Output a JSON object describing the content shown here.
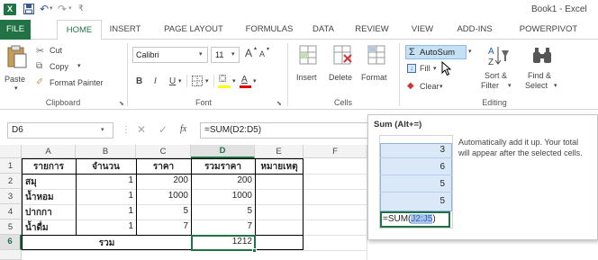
{
  "title": {
    "window_title": "Book1 - Excel",
    "logo_text": "X"
  },
  "quick_access": {
    "save_icon": "save-icon",
    "undo_icon": "undo-icon",
    "redo_icon": "redo-icon",
    "customize_icon": "customize-icon"
  },
  "tabs": [
    "FILE",
    "HOME",
    "INSERT",
    "PAGE LAYOUT",
    "FORMULAS",
    "DATA",
    "REVIEW",
    "VIEW",
    "ADD-INS",
    "POWERPIVOT"
  ],
  "ribbon": {
    "clipboard": {
      "paste": "Paste",
      "cut": "Cut",
      "copy": "Copy",
      "format_painter": "Format Painter",
      "label": "Clipboard"
    },
    "font": {
      "name": "Calibri",
      "size": "11",
      "bold": "B",
      "italic": "I",
      "underline": "U",
      "grow": "A",
      "shrink": "A",
      "label": "Font"
    },
    "cells": {
      "insert": "Insert",
      "delete": "Delete",
      "format": "Format",
      "label": "Cells"
    },
    "editing": {
      "autosum": "AutoSum",
      "fill": "Fill",
      "clear": "Clear",
      "sort_filter_1": "Sort &",
      "sort_filter_2": "Filter",
      "find_select_1": "Find &",
      "find_select_2": "Select",
      "label": "Editing"
    }
  },
  "formula_bar": {
    "name_box": "D6",
    "fx": "fx",
    "formula": "=SUM(D2:D5)"
  },
  "columns": [
    "A",
    "B",
    "C",
    "D",
    "E",
    "F"
  ],
  "rows": [
    "1",
    "2",
    "3",
    "4",
    "5",
    "6"
  ],
  "cells": {
    "A1": "รายการ",
    "B1": "จำนวน",
    "C1": "ราคา",
    "D1": "รวมราคา",
    "E1": "หมายเหตุ",
    "A2": "สมุ",
    "B2": "1",
    "C2": "200",
    "D2": "200",
    "A3": "น้ำหอม",
    "B3": "1",
    "C3": "1000",
    "D3": "1000",
    "A4": "ปากกา",
    "B4": "1",
    "C4": "5",
    "D4": "5",
    "A5": "น้ำดื่ม",
    "B5": "1",
    "C5": "7",
    "D5": "7",
    "A6": "รวม",
    "D6": "1212"
  },
  "tooltip": {
    "title": "Sum (Alt+=)",
    "description_1": "Automatically add it up. Your total",
    "description_2": "will appear after the selected cells.",
    "preview_values": [
      "3",
      "6",
      "5",
      "5"
    ],
    "preview_formula_prefix": "=SUM(",
    "preview_formula_range": "J2:J5",
    "preview_formula_suffix": ")"
  }
}
